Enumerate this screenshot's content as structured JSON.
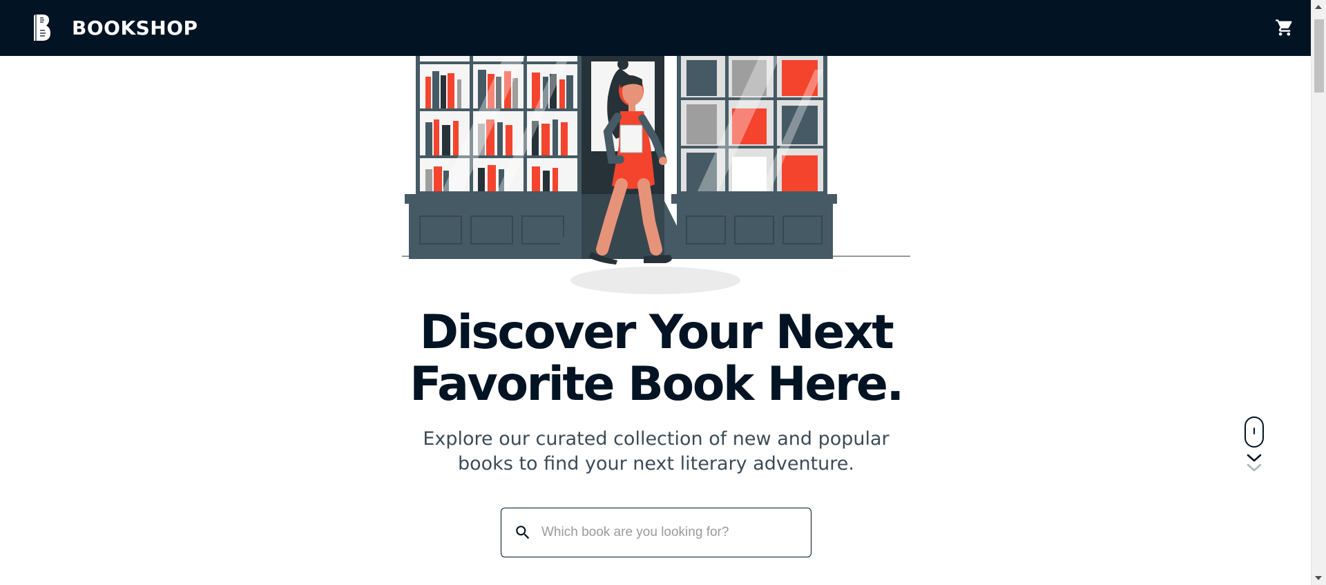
{
  "navbar": {
    "brand_name": "BOOKSHOP",
    "logo_icon": "book-b-logo",
    "cart_icon": "shopping-cart-icon",
    "background_color": "#021323"
  },
  "hero": {
    "title_line1": "Discover Your Next",
    "title_line2": "Favorite Book Here.",
    "subtitle_line1": "Explore our curated collection of new and popular",
    "subtitle_line2": "books to find your next literary adventure.",
    "illustration": "woman-walking-out-of-bookshop-illustration"
  },
  "search": {
    "placeholder": "Which book are you looking for?",
    "value": "",
    "icon": "search-icon"
  },
  "scroll_hint": {
    "icon": "mouse-scroll-icon"
  },
  "colors": {
    "accent": "#f4442e",
    "dark": "#021323",
    "slate": "#455a64",
    "text_muted": "#3d4b57"
  }
}
